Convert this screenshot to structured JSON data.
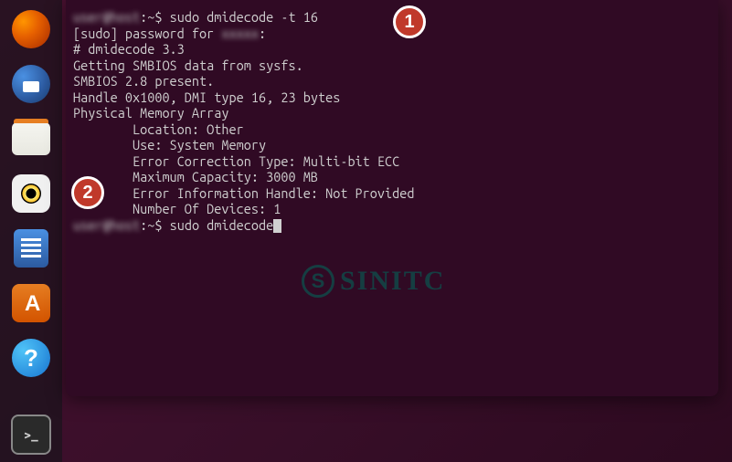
{
  "dock": {
    "items": [
      {
        "name": "firefox-icon"
      },
      {
        "name": "thunderbird-icon"
      },
      {
        "name": "files-icon"
      },
      {
        "name": "rhythmbox-icon"
      },
      {
        "name": "writer-icon"
      },
      {
        "name": "software-icon"
      },
      {
        "name": "help-icon"
      },
      {
        "name": "terminal-icon"
      }
    ]
  },
  "terminal": {
    "prompt1": {
      "user_host": "user@host",
      "sep": ":~$ ",
      "cmd": "sudo dmidecode -t 16"
    },
    "line_pw_prefix": "[sudo] password for ",
    "line_pw_suffix": ":",
    "line_ver": "# dmidecode 3.3",
    "line_get": "Getting SMBIOS data from sysfs.",
    "line_present": "SMBIOS 2.8 present.",
    "line_blank": "",
    "line_handle": "Handle 0x1000, DMI type 16, 23 bytes",
    "line_pma": "Physical Memory Array",
    "line_loc": "        Location: Other",
    "line_use": "        Use: System Memory",
    "line_ecc": "        Error Correction Type: Multi-bit ECC",
    "line_cap": "        Maximum Capacity: 3000 MB",
    "line_err": "        Error Information Handle: Not Provided",
    "line_num": "        Number Of Devices: 1",
    "prompt2": {
      "user_host": "user@host",
      "sep": ":~$ ",
      "cmd": "sudo dmidecode"
    }
  },
  "annotations": {
    "a1": "1",
    "a2": "2"
  },
  "watermark": {
    "logo": "S",
    "text": "SINITC"
  },
  "help_icon_text": "?"
}
